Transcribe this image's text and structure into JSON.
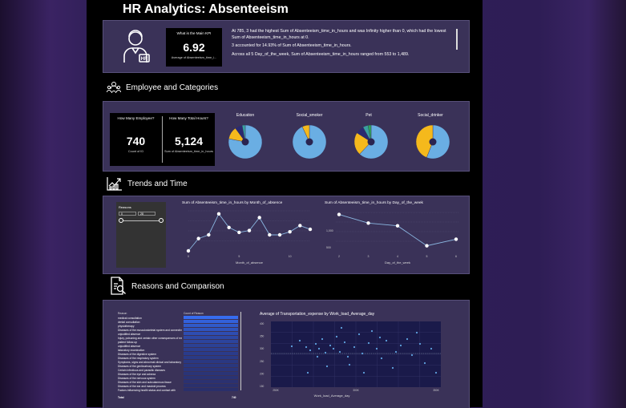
{
  "header": {
    "title": "HR Analytics: Absenteeism"
  },
  "summary": {
    "kpi_caption": "What is the Main KPI",
    "kpi_value": "6.92",
    "kpi_sub": "Average of Absenteeism_time_i...",
    "narrative": [
      "At 785, 3 had the highest Sum of Absenteeism_time_in_hours and was Infinity higher than 0, which had the lowest Sum of Absenteeism_time_in_hours at 0.",
      "3 accounted for 14.93% of Sum of Absenteeism_time_in_hours.",
      "Across all 5 Day_of_the_week, Sum of Absenteeism_time_in_hours ranged from 553 to 1,489."
    ]
  },
  "sections": {
    "employee": "Employee and Categories",
    "trends": "Trends and Time",
    "reasons": "Reasons and Comparison"
  },
  "employees": {
    "card1_caption": "How Many Employee?",
    "card1_value": "740",
    "card1_sub": "Count of ID",
    "card2_caption": "How Many Total Hours?",
    "card2_value": "5,124",
    "card2_sub": "Sum of Absenteeism_time_in_hours"
  },
  "pies": [
    {
      "title": "Education",
      "slices": [
        0.78,
        0.12,
        0.07,
        0.03
      ],
      "colors": [
        "#6aaee3",
        "#f5b91c",
        "#2a2a70",
        "#3aa0a0"
      ]
    },
    {
      "title": "Social_smoker",
      "slices": [
        0.93,
        0.07
      ],
      "colors": [
        "#6aaee3",
        "#f5b91c"
      ]
    },
    {
      "title": "Pet",
      "slices": [
        0.62,
        0.22,
        0.08,
        0.05,
        0.03
      ],
      "colors": [
        "#6aaee3",
        "#f5b91c",
        "#2a2a70",
        "#3aa0a0",
        "#2fa65a"
      ]
    },
    {
      "title": "Social_drinker",
      "slices": [
        0.56,
        0.44
      ],
      "colors": [
        "#6aaee3",
        "#f5b91c"
      ]
    }
  ],
  "slicer": {
    "label": "Reasons",
    "from": "0",
    "to": "28"
  },
  "chart_month": {
    "title": "Sum of Absenteeism_time_in_hours by Month_of_absence",
    "xlabel": "Month_of_absence",
    "x": [
      0,
      1,
      2,
      3,
      4,
      5,
      6,
      7,
      8,
      9,
      10,
      11,
      12
    ],
    "y": [
      0,
      200,
      260,
      600,
      380,
      300,
      330,
      540,
      260,
      260,
      310,
      410,
      350
    ],
    "x_ticks": [
      "0",
      "5",
      "10"
    ]
  },
  "chart_day": {
    "title": "Sum of Absenteeism_time_in_hours by Day_of_the_week",
    "xlabel": "Day_of_the_week",
    "x": [
      2,
      3,
      4,
      5,
      6
    ],
    "y": [
      1489,
      1230,
      1150,
      553,
      750
    ],
    "x_ticks": [
      "2",
      "3",
      "4",
      "5",
      "6"
    ],
    "y_ticks": [
      "1,000",
      "500"
    ]
  },
  "reasons_table": {
    "col1": "Reason",
    "col2": "Count of Reason",
    "rows": [
      "medical consultation",
      "dental consultation",
      "physiotherapy",
      "Diseases of the musculoskeletal system and connective tissue",
      "unjustified absence",
      "Injury, poisoning and certain other consequences of external causes",
      "patient follow-up",
      "unjustified absence",
      "laboratory examination",
      "Diseases of the digestive system",
      "Diseases of the respiratory system",
      "Symptoms, signs and abnormal clinical and laboratory findings, not elsewhere classified",
      "Diseases of the genitourinary system",
      "Certain infectious and parasitic diseases",
      "Diseases of the eye and adnexa",
      "Diseases of the nervous system",
      "Diseases of the skin and subcutaneous tissue",
      "Diseases of the ear and mastoid process",
      "Factors influencing health status and contact with"
    ],
    "total_label": "Total",
    "total_value": "740"
  },
  "chart_scatter": {
    "title": "Average of Transportation_expense by Work_load_Average_day",
    "xlabel": "Work_load_Average_day",
    "x_ticks": [
      "250K",
      "300K",
      "350K"
    ],
    "y_ticks": [
      "400",
      "350",
      "300",
      "250",
      "200",
      "150"
    ]
  },
  "colors": {
    "accent": "#6aaee3",
    "yellow": "#f5b91c",
    "panel": "#3a3258"
  }
}
